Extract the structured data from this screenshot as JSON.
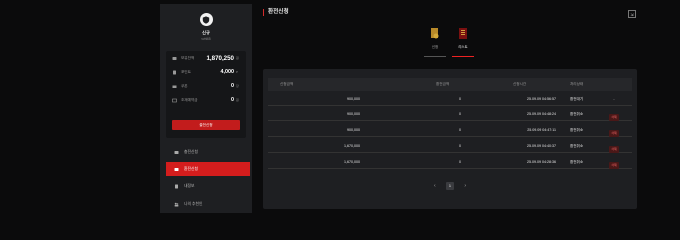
{
  "user": {
    "name": "신규",
    "id": "vvhl65"
  },
  "balances": [
    {
      "label": "보유잔액",
      "value": "1,870,250",
      "unit": "원",
      "icon": "wallet-icon"
    },
    {
      "label": "포인트",
      "value": "4,000",
      "unit": "P",
      "icon": "point-icon"
    },
    {
      "label": "쿠폰",
      "value": "0",
      "unit": "장",
      "icon": "coupon-icon"
    },
    {
      "label": "조재예약금",
      "value": "0",
      "unit": "원",
      "icon": "card-icon"
    }
  ],
  "sidebar_button": "출전신청",
  "nav": [
    {
      "label": "충전신청",
      "icon": "charge-icon"
    },
    {
      "label": "환전신청",
      "icon": "exchange-icon"
    },
    {
      "label": "내정보",
      "icon": "user-icon"
    },
    {
      "label": "나의 추천인",
      "icon": "people-icon"
    }
  ],
  "page_title": "환전신청",
  "expand_label": "⇲",
  "tabs": [
    {
      "label": "신청",
      "icon": "apply-icon"
    },
    {
      "label": "리스트",
      "icon": "list-icon"
    }
  ],
  "table": {
    "headers": [
      "신청금액",
      "환전금액",
      "신청시간",
      "처리상태"
    ],
    "rows": [
      {
        "amount": "900,000",
        "exchanged": "0",
        "time": "25.09.09 04:56:57",
        "status": "환전대기",
        "action": "-"
      },
      {
        "amount": "900,000",
        "exchanged": "0",
        "time": "25.09.09 04:48:24",
        "status": "환전취소",
        "action": "삭제"
      },
      {
        "amount": "900,000",
        "exchanged": "0",
        "time": "25.09.09 04:47:11",
        "status": "환전취소",
        "action": "삭제"
      },
      {
        "amount": "1,670,000",
        "exchanged": "0",
        "time": "25.09.09 04:40:37",
        "status": "환전취소",
        "action": "삭제"
      },
      {
        "amount": "1,670,000",
        "exchanged": "0",
        "time": "25.09.09 04:28:36",
        "status": "환전취소",
        "action": "삭제"
      }
    ]
  },
  "pagination": {
    "prev": "‹",
    "current": "1",
    "next": "›"
  },
  "colors": {
    "accent": "#d41d1d",
    "panel": "#1e1f22",
    "background": "#0b0b0c"
  }
}
